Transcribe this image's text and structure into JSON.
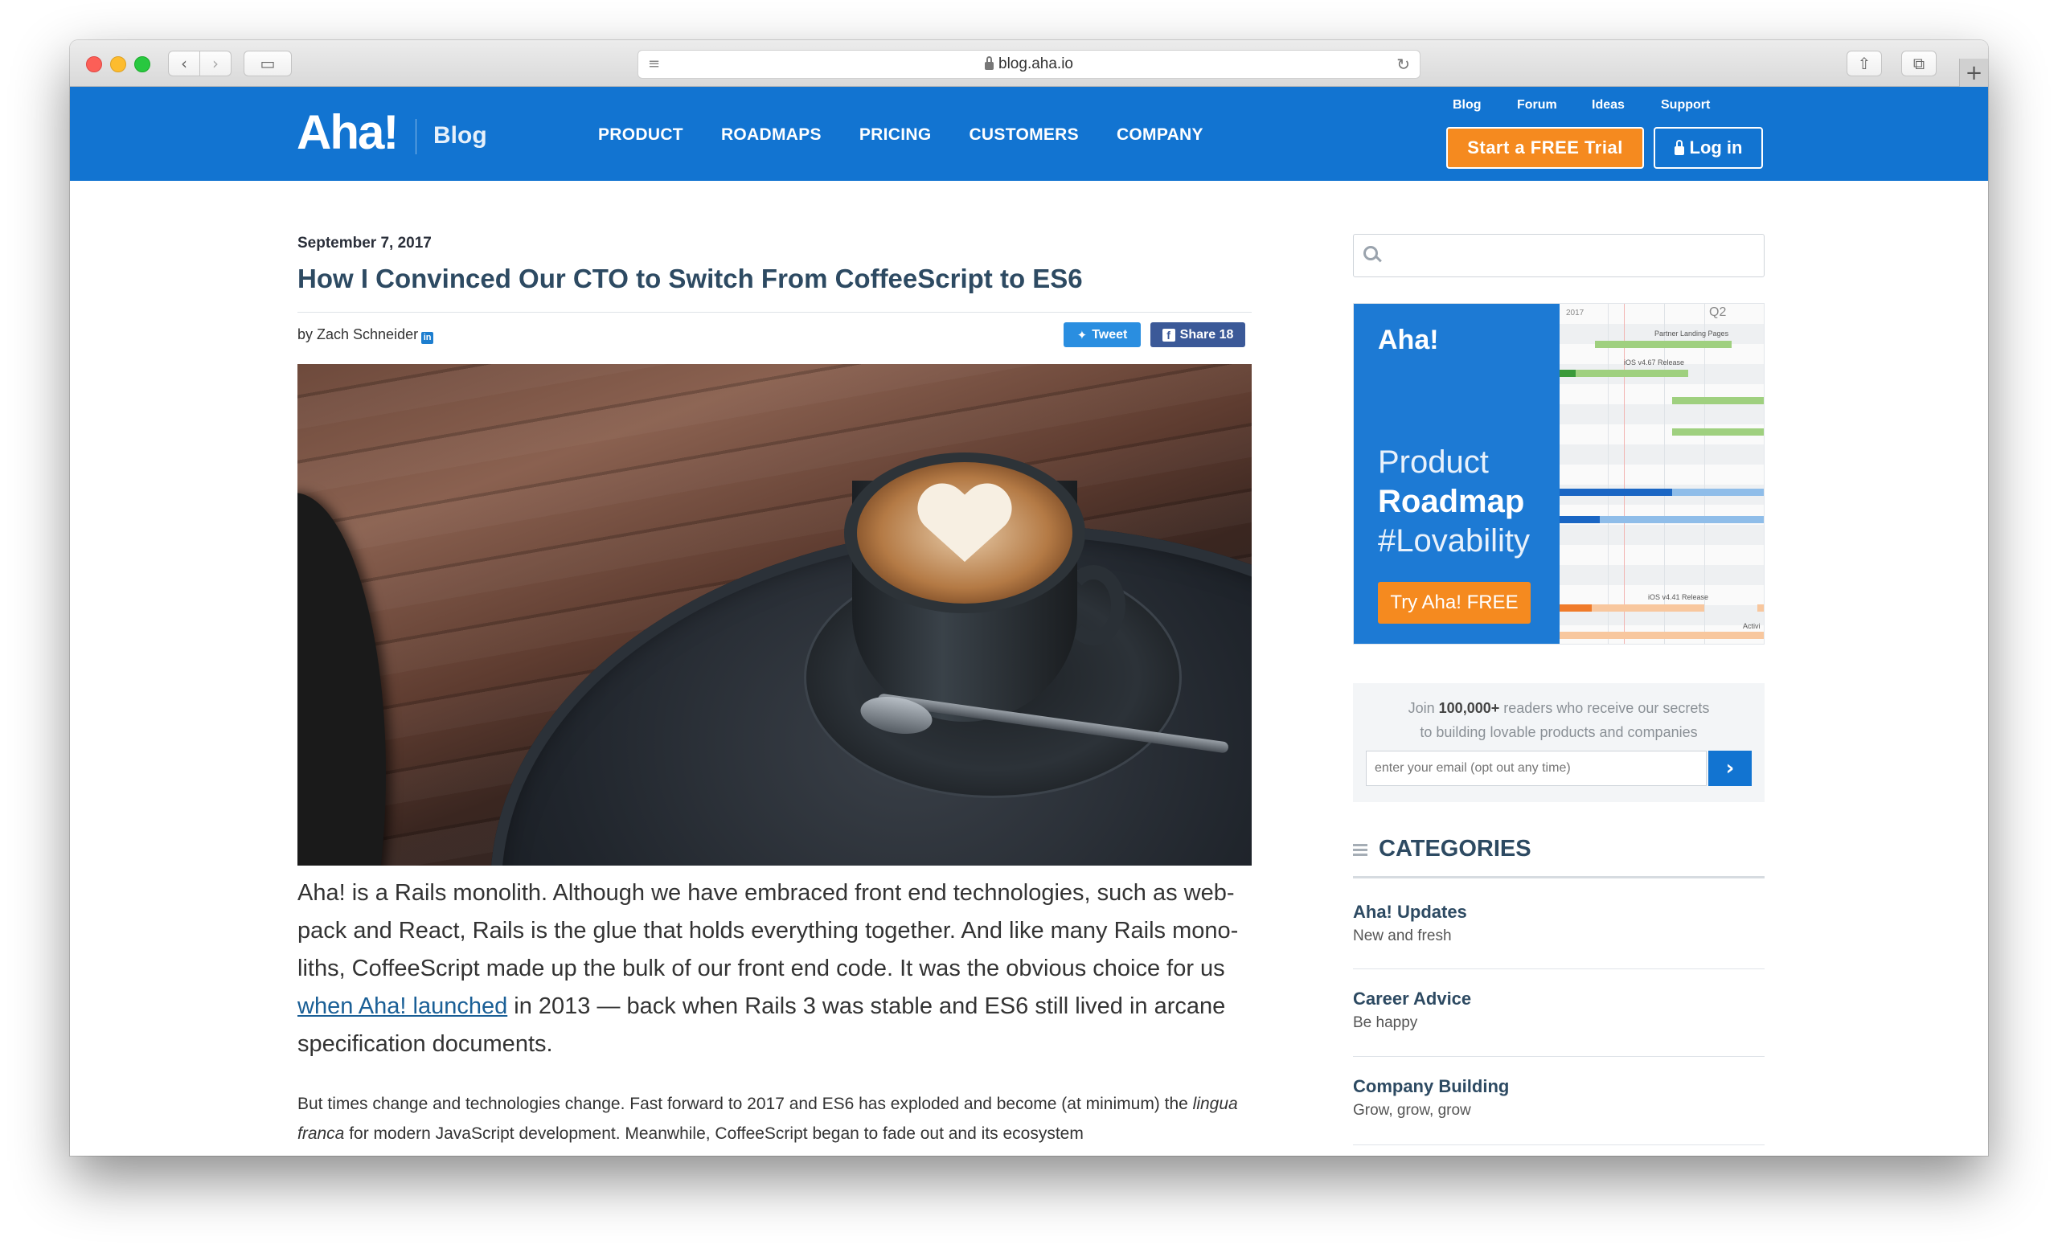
{
  "browser": {
    "url": "blog.aha.io"
  },
  "header": {
    "logo": "Aha!",
    "logo_section": "Blog",
    "nav": [
      "PRODUCT",
      "ROADMAPS",
      "PRICING",
      "CUSTOMERS",
      "COMPANY"
    ],
    "util_links": [
      "Blog",
      "Forum",
      "Ideas",
      "Support"
    ],
    "trial_button": "Start a FREE Trial",
    "login_button": "Log in"
  },
  "article": {
    "date": "September 7, 2017",
    "title": "How I Convinced Our CTO to Switch From CoffeeScript to ES6",
    "byline": "by Zach Schneider",
    "tweet_label": "Tweet",
    "share_label": "Share",
    "share_count": "18",
    "lead_p1": "Aha! is a Rails monolith. Although we have embraced front end technologies, such as web-pack and React, Rails is the glue that holds everything together. And like many Rails mono-liths, CoffeeScript made up the bulk of our front end code. It was the obvious choice for us ",
    "lead_link": "when Aha! launched",
    "lead_p2": " in 2013 — back when Rails 3 was stable and ES6 still lived in arcane specification documents.",
    "body_p1": "But times change and technologies change. Fast forward to 2017 and ES6 has exploded and become (at minimum) the ",
    "body_em": "lingua franca",
    "body_p2": " for modern JavaScript development. Meanwhile, CoffeeScript began to fade out and its ecosystem"
  },
  "sidebar": {
    "search_placeholder": "",
    "ad": {
      "logo": "Aha!",
      "line1": "Product",
      "line2": "Roadmap",
      "line3": "#Lovability",
      "button": "Try Aha! FREE",
      "quarter": "Q2",
      "year": "2017",
      "labels": [
        "Partner Landing Pages",
        "iOS v4.67 Release",
        "iOS v4.41 Release",
        "Activi"
      ]
    },
    "newsletter": {
      "line1_pre": "Join ",
      "line1_bold": "100,000+",
      "line1_post": " readers who receive our secrets",
      "line2": "to building lovable products and companies",
      "placeholder": "enter your email (opt out any time)"
    },
    "categories_title": "CATEGORIES",
    "categories": [
      {
        "name": "Aha! Updates",
        "sub": "New and fresh"
      },
      {
        "name": "Career Advice",
        "sub": "Be happy"
      },
      {
        "name": "Company Building",
        "sub": "Grow, grow, grow"
      }
    ]
  },
  "colors": {
    "brand_blue": "#1274d1",
    "accent_orange": "#f58a1f"
  }
}
